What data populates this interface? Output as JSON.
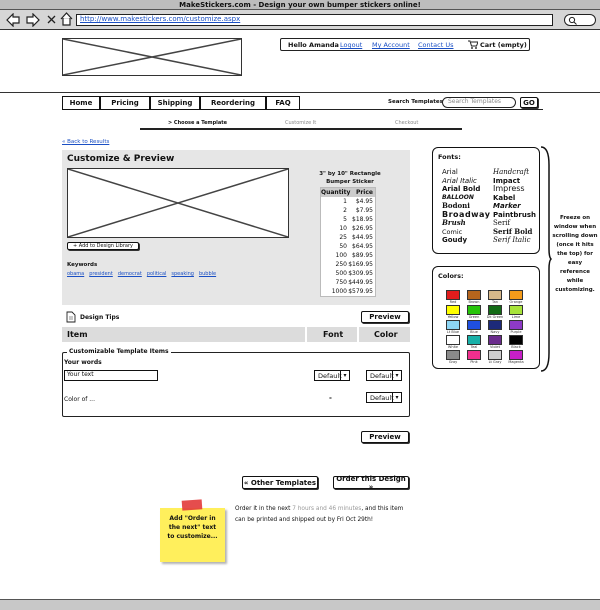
{
  "window": {
    "title": "MakeStickers.com - Design your own bumper stickers online!"
  },
  "browser": {
    "url": "http://www.makestickers.com/customize.aspx",
    "back_icon": "back-arrow-icon",
    "forward_icon": "forward-arrow-icon",
    "stop_icon": "close-icon",
    "home_icon": "home-icon",
    "search_icon": "search-icon"
  },
  "header": {
    "greeting": "Hello Amanda",
    "logout": "Logout",
    "my_account": "My Account",
    "contact_us": "Contact Us",
    "cart": "Cart (empty)"
  },
  "nav": {
    "tabs": [
      "Home",
      "Pricing",
      "Shipping",
      "Reordering",
      "FAQ"
    ],
    "search_label": "Search Templates:",
    "search_placeholder": "Search Templates",
    "go": "GO"
  },
  "steps": {
    "step1": "> Choose a Template",
    "step2": "Customize It",
    "step3": "Checkout"
  },
  "back_link": "« Back to Results",
  "preview": {
    "title": "Customize & Preview",
    "add_library": "+ Add to Design Library",
    "keywords_label": "Keywords",
    "keywords": [
      "obama",
      "president",
      "democrat",
      "political",
      "speaking",
      "bubble"
    ]
  },
  "product": {
    "title_line1": "3\" by 10\" Rectangle",
    "title_line2": "Bumper Sticker",
    "qty_header": "Quantity",
    "price_header": "Price",
    "rows": [
      [
        "1",
        "$4.95"
      ],
      [
        "2",
        "$7.95"
      ],
      [
        "5",
        "$18.95"
      ],
      [
        "10",
        "$26.95"
      ],
      [
        "25",
        "$44.95"
      ],
      [
        "50",
        "$64.95"
      ],
      [
        "100",
        "$89.95"
      ],
      [
        "250",
        "$169.95"
      ],
      [
        "500",
        "$309.95"
      ],
      [
        "750",
        "$449.95"
      ],
      [
        "1000",
        "$579.95"
      ]
    ]
  },
  "design_tips": {
    "label": "Design Tips",
    "preview_button": "Preview",
    "col_item": "Item",
    "col_font": "Font",
    "col_color": "Color"
  },
  "template_items": {
    "legend": "Customizable Template Items",
    "your_words_label": "Your words",
    "your_text_value": "Your text",
    "font_default": "Default",
    "color_default": "Default",
    "color_of_label": "Color of ...",
    "dash": "-",
    "preview_button": "Preview"
  },
  "fonts": {
    "title": "Fonts:",
    "left": [
      "Arial",
      "Arial Italic",
      "Arial Bold",
      "BALLOON",
      "Bodoni",
      "Broadway",
      "Brush",
      "Comic",
      "Goudy"
    ],
    "right": [
      "Handcraft",
      "Impact",
      "Impress",
      "Kabel",
      "Marker",
      "Paintbrush",
      "Serif",
      "Serif Bold",
      "Serif Italic"
    ]
  },
  "colors": {
    "title": "Colors:",
    "swatches": [
      {
        "label": "Red",
        "hex": "#e11d1d"
      },
      {
        "label": "Brown",
        "hex": "#b5651d"
      },
      {
        "label": "Tan",
        "hex": "#d8b98a"
      },
      {
        "label": "Orange",
        "hex": "#f59b1a"
      },
      {
        "label": "Yellow",
        "hex": "#ffff00"
      },
      {
        "label": "Green",
        "hex": "#27c40a"
      },
      {
        "label": "Dk Green",
        "hex": "#136b16"
      },
      {
        "label": "Lime",
        "hex": "#a7e33a"
      },
      {
        "label": "Lt Blue",
        "hex": "#8dd6f5"
      },
      {
        "label": "Blue",
        "hex": "#1f4fe0"
      },
      {
        "label": "Navy",
        "hex": "#1d2a7a"
      },
      {
        "label": "Purple",
        "hex": "#8e3ac7"
      },
      {
        "label": "White",
        "hex": "#ffffff"
      },
      {
        "label": "Teal",
        "hex": "#18b0a8"
      },
      {
        "label": "Violet",
        "hex": "#6a2b8c"
      },
      {
        "label": "Black",
        "hex": "#000000"
      },
      {
        "label": "Gray",
        "hex": "#8a8a8a"
      },
      {
        "label": "Pink",
        "hex": "#f02f8e"
      },
      {
        "label": "Lt Gray",
        "hex": "#cfcfcf"
      },
      {
        "label": "Magenta",
        "hex": "#c71fc7"
      }
    ]
  },
  "annotation": {
    "freeze_note": "Freeze on window when scrolling down (once it hits the top) for easy reference while customizing.",
    "sticky_note": "Add \"Order in the next\" text to customize..."
  },
  "bottom": {
    "other_templates": "« Other Templates",
    "order_design": "Order this Design »",
    "order_text_1": "Order it in the next ",
    "order_time": "7 hours and 46 minutes",
    "order_text_2": ", and this item can be printed and shipped out by Fri Oct 29th!"
  }
}
